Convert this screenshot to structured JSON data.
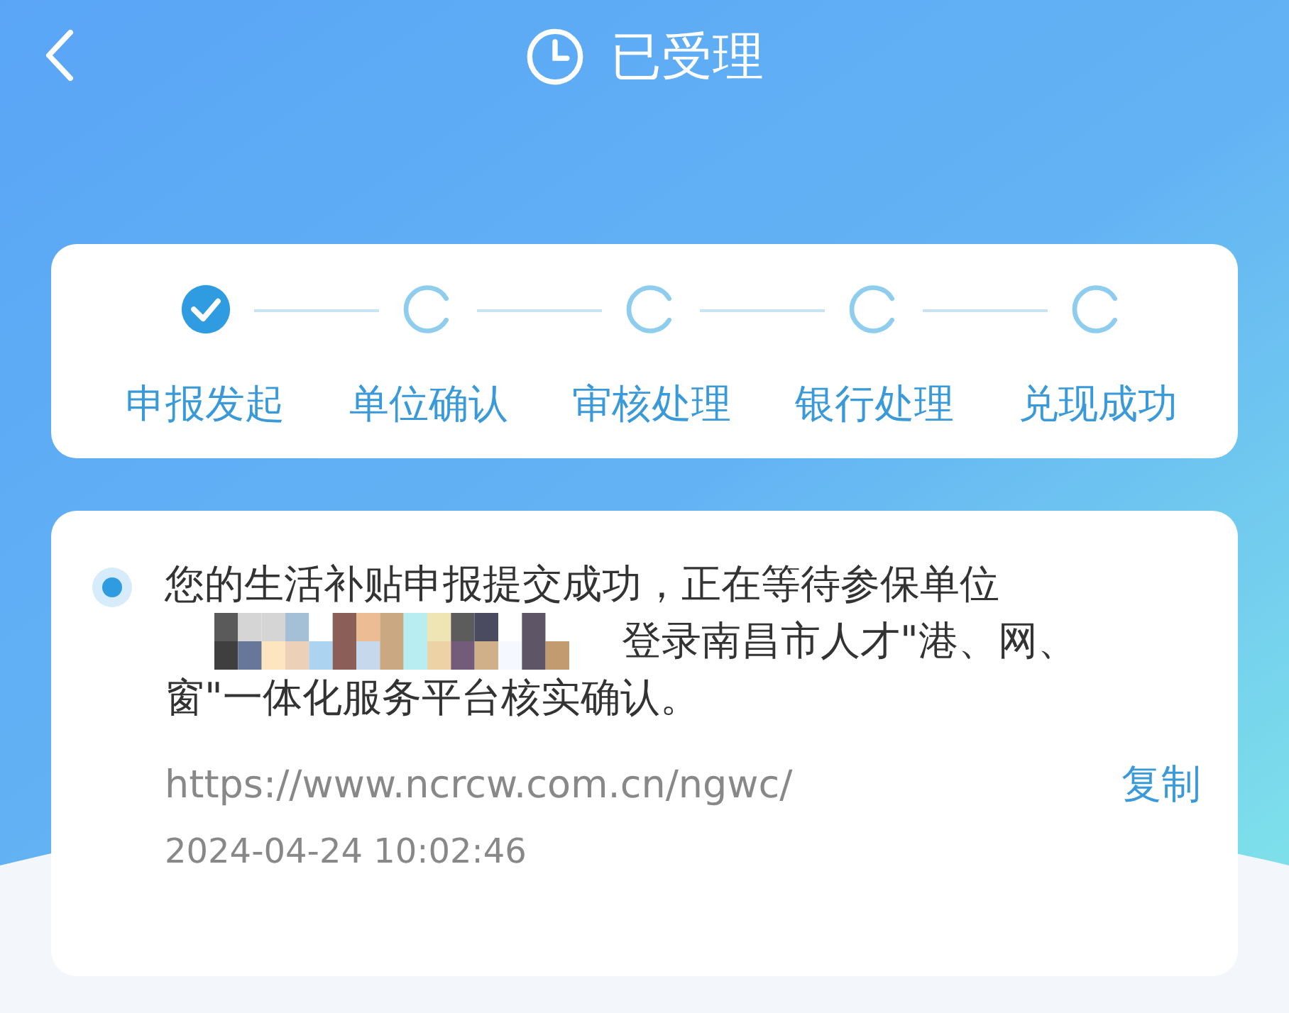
{
  "header": {
    "title": "已受理"
  },
  "steps": [
    {
      "label": "申报发起",
      "done": true
    },
    {
      "label": "单位确认",
      "done": false
    },
    {
      "label": "审核处理",
      "done": false
    },
    {
      "label": "银行处理",
      "done": false
    },
    {
      "label": "兑现成功",
      "done": false
    }
  ],
  "record": {
    "message_lines": [
      "您的生活补贴申报提交成功，正在等待参保单位",
      "登录南昌市人才\"港、网、",
      "窗\"一体化服务平台核实确认。"
    ],
    "redacted": true,
    "link": "https://www.ncrcw.com.cn/ngwc/",
    "copy_label": "复制",
    "time": "2024-04-24 10:02:46"
  }
}
